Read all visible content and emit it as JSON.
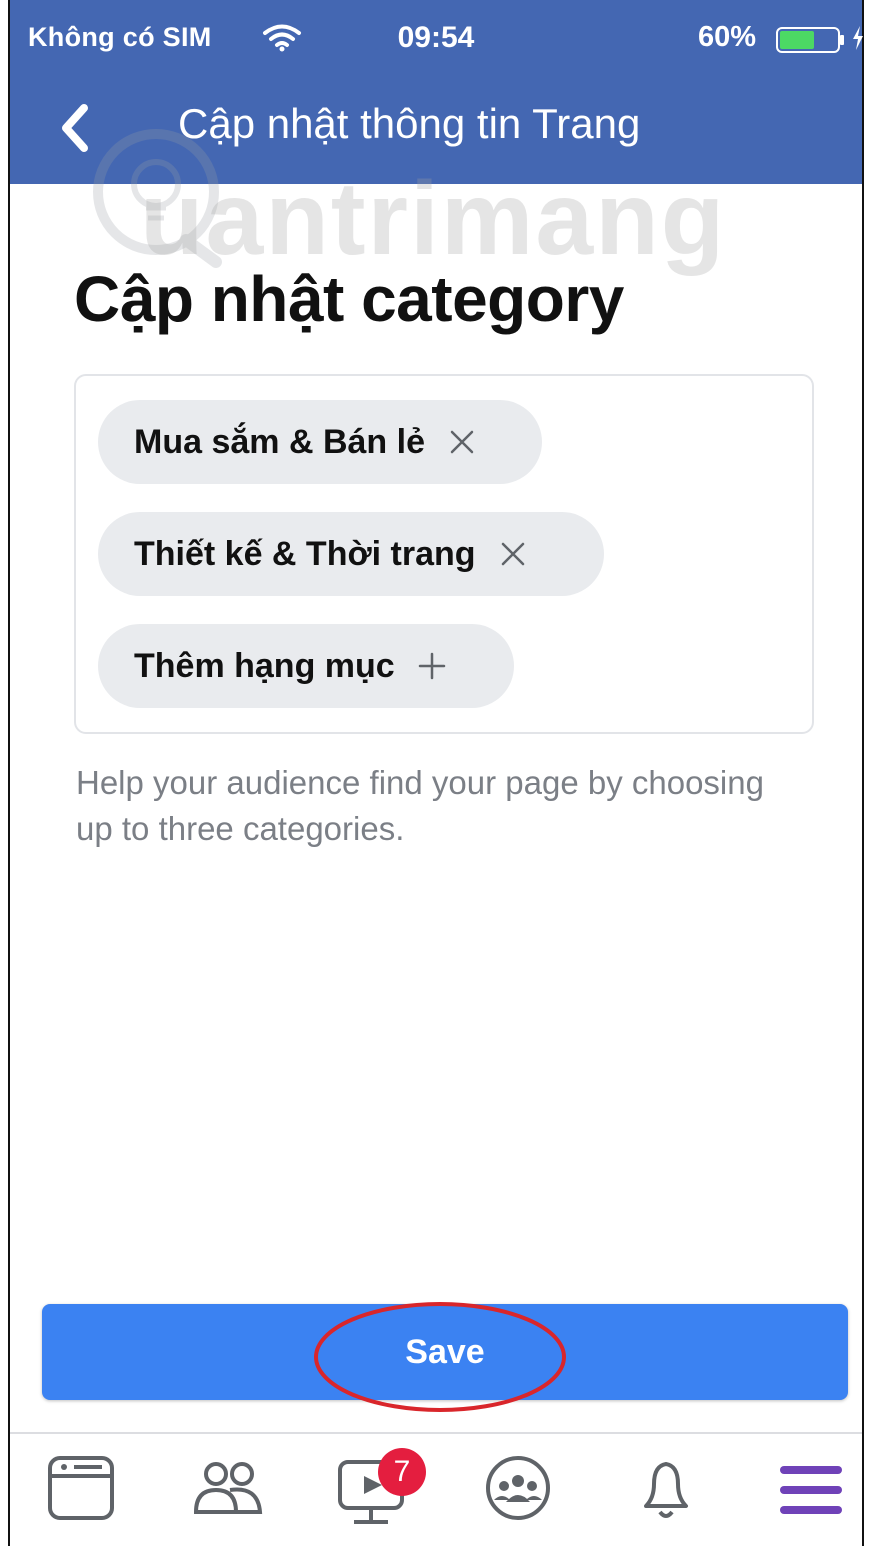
{
  "status_bar": {
    "carrier": "Không có SIM",
    "time": "09:54",
    "battery_percent": "60%",
    "battery_level": 0.6,
    "wifi_icon": "wifi-icon",
    "battery_icon": "battery-icon",
    "charging_icon": "bolt-icon"
  },
  "nav": {
    "back_icon": "chevron-left-icon",
    "title": "Cập nhật thông tin Trang"
  },
  "watermark": "uantrimang",
  "page": {
    "title": "Cập nhật category",
    "chips": [
      {
        "label": "Mua sắm & Bán lẻ",
        "icon": "close-icon"
      },
      {
        "label": "Thiết kế & Thời trang",
        "icon": "close-icon"
      },
      {
        "label": "Thêm hạng mục",
        "icon": "plus-icon"
      }
    ],
    "helper_text": "Help your audience find your page by choosing up to three categories."
  },
  "save_label": "Save",
  "tab_bar": {
    "tabs": [
      "feed-icon",
      "friends-icon",
      "watch-icon",
      "groups-icon",
      "notifications-icon",
      "menu-icon"
    ],
    "watch_badge": "7",
    "active_tab": "menu-icon"
  },
  "colors": {
    "header": "#4467b2",
    "primary_button": "#3b82f2",
    "chip_background": "#e9ebee",
    "badge": "#e41e3f",
    "active_tab": "#6f42b8",
    "annotation": "#d9262b"
  }
}
